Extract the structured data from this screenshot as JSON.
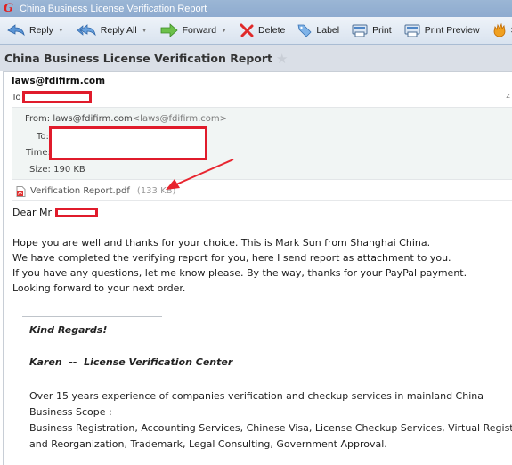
{
  "window": {
    "title": "China Business License Verification Report",
    "app_icon": "foxmail-logo-icon"
  },
  "toolbar": {
    "buttons": [
      {
        "label": "Reply",
        "icon": "reply-icon",
        "has_dropdown": true
      },
      {
        "label": "Reply All",
        "icon": "reply-all-icon",
        "has_dropdown": true
      },
      {
        "label": "Forward",
        "icon": "forward-icon",
        "has_dropdown": true
      },
      {
        "label": "Delete",
        "icon": "delete-icon",
        "has_dropdown": false
      },
      {
        "label": "Label",
        "icon": "tag-icon",
        "has_dropdown": false
      },
      {
        "label": "Print",
        "icon": "printer-icon",
        "has_dropdown": false
      },
      {
        "label": "Print Preview",
        "icon": "print-preview-icon",
        "has_dropdown": false
      },
      {
        "label": "Spam",
        "icon": "spam-flame-icon",
        "has_dropdown": false
      }
    ],
    "dropdown_glyph": "▼"
  },
  "message": {
    "subject": "China Business License Verification Report",
    "star_glyph": "★",
    "sender": "laws@fdifirm.com",
    "to_label": "To",
    "corner_mark": "z",
    "details": {
      "from_label": "From:",
      "from_name": "laws@fdifirm.com",
      "from_address": "<laws@fdifirm.com>",
      "to_label": "To:",
      "time_label": "Time:",
      "size_label": "Size:",
      "size_value": "190 KB"
    },
    "attachment": {
      "filename": "Verification Report.pdf",
      "size": "(133 KB)",
      "icon": "pdf-file-icon"
    },
    "body": {
      "greeting": "Dear Mr",
      "paragraph": [
        "Hope you are well and thanks for your choice. This is Mark Sun from Shanghai China.",
        "We have completed the verifying report for you, here I send report as attachment to you.",
        "If you have any questions, let me know please. By the way, thanks for your PayPal payment.",
        "Looking forward to your next order."
      ]
    },
    "signature": {
      "closing": "Kind Regards!",
      "name_line": "Karen  --  License Verification Center",
      "experience": "Over 15 years experience of companies verification and checkup services in mainland China",
      "scope_label": "Business Scope :",
      "scope_line1": "Business Registration, Accounting Services, Chinese Visa, License Checkup Services, Virtual Registered Office",
      "scope_line2": "and Reorganization, Trademark, Legal Consulting, Government Approval."
    }
  },
  "colors": {
    "redaction": "#e01b2b",
    "annotation_arrow": "#e8252f",
    "titlebar": "#9bb6d5"
  }
}
